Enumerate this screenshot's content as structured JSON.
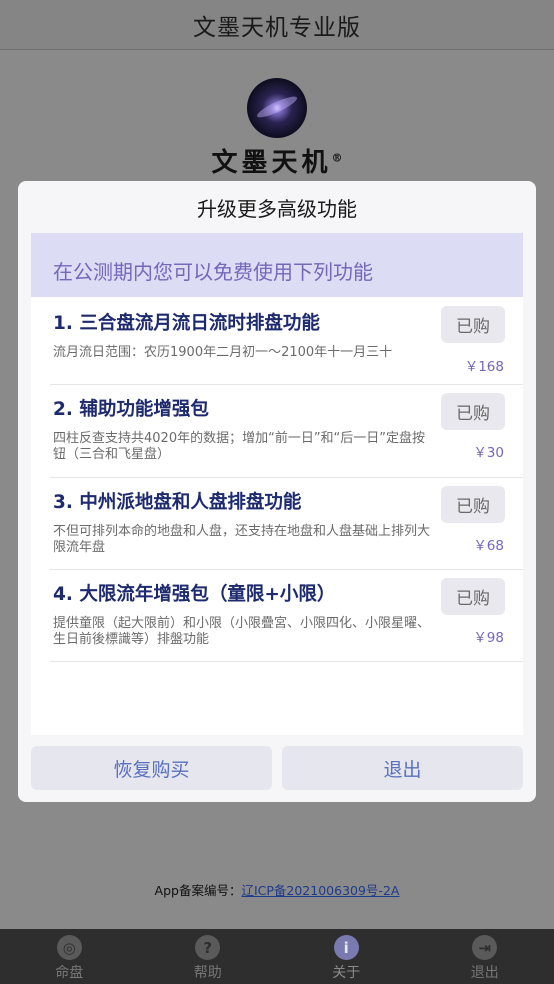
{
  "app": {
    "title": "文墨天机专业版"
  },
  "logo": {
    "text": "文墨天机",
    "registered": "®"
  },
  "icp": {
    "label": "App备案编号：",
    "number": "辽ICP备2021006309号-2A"
  },
  "nav": [
    {
      "label": "命盘",
      "icon": "chart-icon",
      "glyph": "◎"
    },
    {
      "label": "帮助",
      "icon": "help-icon",
      "glyph": "?"
    },
    {
      "label": "关于",
      "icon": "info-icon",
      "glyph": "i"
    },
    {
      "label": "退出",
      "icon": "exit-icon",
      "glyph": "⇥"
    }
  ],
  "modal": {
    "title": "升级更多高级功能",
    "banner": "在公测期内您可以免费使用下列功能",
    "items": [
      {
        "title": "1. 三合盘流月流日流时排盘功能",
        "desc": "流月流日范围：农历1900年二月初一～2100年十一月三十",
        "button": "已购",
        "price": "￥168"
      },
      {
        "title": "2. 辅助功能增强包",
        "desc": "四柱反查支持共4020年的数据；增加“前一日”和“后一日”定盘按钮（三合和飞星盘）",
        "button": "已购",
        "price": "￥30"
      },
      {
        "title": "3. 中州派地盘和人盘排盘功能",
        "desc": "不但可排列本命的地盘和人盘，还支持在地盘和人盘基础上排列大限流年盘",
        "button": "已购",
        "price": "￥68"
      },
      {
        "title": "4. 大限流年增强包（童限+小限）",
        "desc": "提供童限（起大限前）和小限（小限疊宮、小限四化、小限星曜、生日前後標識等）排盤功能",
        "button": "已购",
        "price": "￥98"
      }
    ],
    "restore_label": "恢复购买",
    "exit_label": "退出"
  },
  "colors": {
    "accent": "#7468b8",
    "title_text": "#1d2a6e",
    "link": "#5a70c0"
  }
}
